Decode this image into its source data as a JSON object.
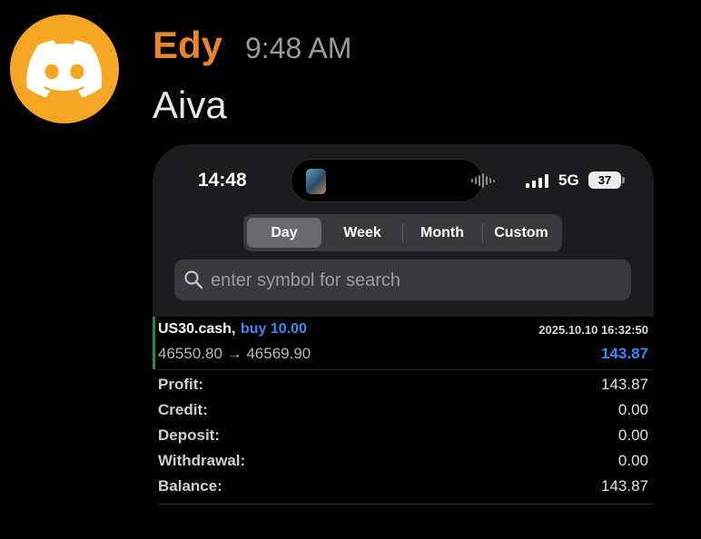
{
  "message": {
    "author": "Edy",
    "timestamp": "9:48 AM",
    "text": "Aiva"
  },
  "phone": {
    "status_bar": {
      "time": "14:48",
      "network": "5G",
      "battery": "37"
    },
    "period_tabs": [
      {
        "label": "Day",
        "active": true
      },
      {
        "label": "Week",
        "active": false
      },
      {
        "label": "Month",
        "active": false
      },
      {
        "label": "Custom",
        "active": false
      }
    ],
    "search": {
      "placeholder": "enter symbol for search"
    },
    "trade": {
      "symbol": "US30.cash,",
      "side_volume": "buy 10.00",
      "datetime": "2025.10.10 16:32:50",
      "prices": "46550.80 → 46569.90",
      "profit": "143.87"
    },
    "summary": [
      {
        "label": "Profit:",
        "value": "143.87"
      },
      {
        "label": "Credit:",
        "value": "0.00"
      },
      {
        "label": "Deposit:",
        "value": "0.00"
      },
      {
        "label": "Withdrawal:",
        "value": "0.00"
      },
      {
        "label": "Balance:",
        "value": "143.87"
      }
    ]
  },
  "colors": {
    "author": "#e6862b",
    "avatar": "#f5a623",
    "buy_blue": "#3c88f5",
    "trade_bar": "#1e8f3c"
  },
  "icons": [
    "discord-logo",
    "search-icon",
    "signal-icon",
    "battery-icon"
  ]
}
